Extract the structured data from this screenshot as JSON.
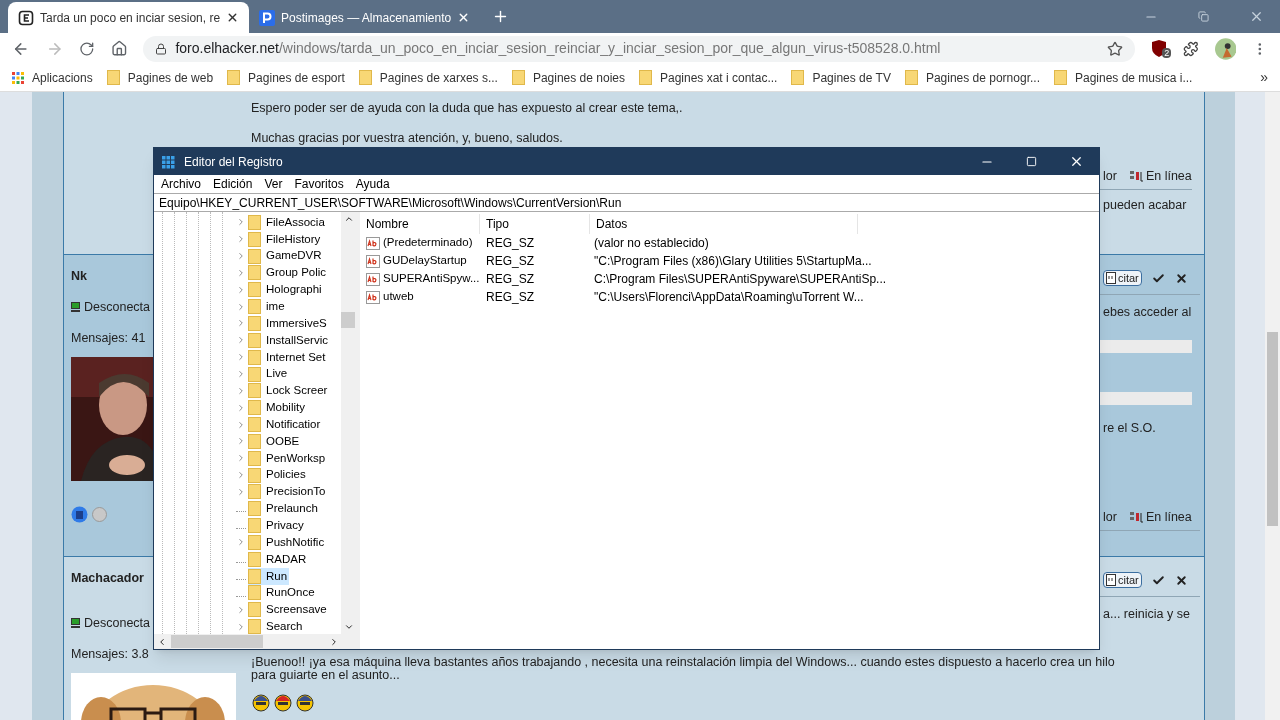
{
  "browser": {
    "tabs": [
      {
        "title": "Tarda un poco en inciar sesion, re",
        "kind": "forum",
        "selected": true
      },
      {
        "title": "Postimages — Almacenamiento",
        "kind": "postimages",
        "selected": false
      }
    ],
    "url": {
      "host": "foro.elhacker.net",
      "path": "/windows/tarda_un_poco_en_inciar_sesion_reinciar_y_inciar_sesion_por_que_algun_virus-t508528.0.html"
    },
    "extension_badge": "2",
    "bookmarks": [
      {
        "label": "Aplicacions",
        "kind": "apps"
      },
      {
        "label": "Pagines de web",
        "kind": "folder"
      },
      {
        "label": "Pagines de esport",
        "kind": "folder"
      },
      {
        "label": "Pagines de xarxes s...",
        "kind": "folder"
      },
      {
        "label": "Pagines de noies",
        "kind": "folder"
      },
      {
        "label": "Pagines xat i contac...",
        "kind": "folder"
      },
      {
        "label": "Pagines de TV",
        "kind": "folder"
      },
      {
        "label": "Pagines de pornogr...",
        "kind": "folder"
      },
      {
        "label": "Pagines de musica i...",
        "kind": "folder"
      }
    ],
    "bookmarks_overflow": "»"
  },
  "forum": {
    "top_post": {
      "lines": [
        "Espero poder ser de ayuda con la duda que has expuesto al crear este tema,.",
        "Muchas gracias por vuestra atención, y, bueno, saludos."
      ],
      "footer_left": "lor",
      "footer_status": "En línea",
      "side_text": "pueden acabar"
    },
    "posts": [
      {
        "author": "Nk",
        "status": "Desconecta",
        "messages": "Mensajes: 41",
        "quote": "citar",
        "side_text": [
          "ebes acceder al",
          "re el S.O."
        ],
        "footer_left": "lor",
        "footer_status": "En línea"
      },
      {
        "author": "Machacador",
        "status": "Desconecta",
        "messages": "Mensajes: 3.8",
        "quote": "citar",
        "side_text": [
          "a... reinicia y se"
        ],
        "body": [
          "¡Buenoo!! ¡ya esa máquina lleva bastantes años trabajando , necesita una reinstalación limpia del Windows... cuando estes dispuesto a hacerlo crea un hilo",
          "para guiarte en el asunto..."
        ],
        "smileys": [
          {
            "color": "#3b4f8a"
          },
          {
            "color": "#d52525"
          },
          {
            "color": "#3b4f8a"
          }
        ]
      }
    ]
  },
  "window": {
    "title": "Editor del Registro",
    "menu": [
      "Archivo",
      "Edición",
      "Ver",
      "Favoritos",
      "Ayuda"
    ],
    "address": "Equipo\\HKEY_CURRENT_USER\\SOFTWARE\\Microsoft\\Windows\\CurrentVersion\\Run",
    "tree": [
      {
        "label": "FileAssocia",
        "expandable": true,
        "selected": false
      },
      {
        "label": "FileHistory",
        "expandable": true,
        "selected": false
      },
      {
        "label": "GameDVR",
        "expandable": true,
        "selected": false
      },
      {
        "label": "Group Polic",
        "expandable": true,
        "selected": false
      },
      {
        "label": "Holographi",
        "expandable": true,
        "selected": false
      },
      {
        "label": "ime",
        "expandable": true,
        "selected": false
      },
      {
        "label": "ImmersiveS",
        "expandable": true,
        "selected": false
      },
      {
        "label": "InstallServic",
        "expandable": true,
        "selected": false
      },
      {
        "label": "Internet Set",
        "expandable": true,
        "selected": false
      },
      {
        "label": "Live",
        "expandable": true,
        "selected": false
      },
      {
        "label": "Lock Screer",
        "expandable": true,
        "selected": false
      },
      {
        "label": "Mobility",
        "expandable": true,
        "selected": false
      },
      {
        "label": "Notificatior",
        "expandable": true,
        "selected": false
      },
      {
        "label": "OOBE",
        "expandable": true,
        "selected": false
      },
      {
        "label": "PenWorksp",
        "expandable": true,
        "selected": false
      },
      {
        "label": "Policies",
        "expandable": true,
        "selected": false
      },
      {
        "label": "PrecisionTo",
        "expandable": true,
        "selected": false
      },
      {
        "label": "Prelaunch",
        "expandable": false,
        "selected": false
      },
      {
        "label": "Privacy",
        "expandable": false,
        "selected": false
      },
      {
        "label": "PushNotific",
        "expandable": true,
        "selected": false
      },
      {
        "label": "RADAR",
        "expandable": false,
        "selected": false
      },
      {
        "label": "Run",
        "expandable": false,
        "selected": true
      },
      {
        "label": "RunOnce",
        "expandable": false,
        "selected": false
      },
      {
        "label": "Screensave",
        "expandable": true,
        "selected": false
      },
      {
        "label": "Search",
        "expandable": true,
        "selected": false
      }
    ],
    "columns": [
      "Nombre",
      "Tipo",
      "Datos"
    ],
    "rows": [
      {
        "name": "(Predeterminado)",
        "type": "REG_SZ",
        "data": "(valor no establecido)"
      },
      {
        "name": "GUDelayStartup",
        "type": "REG_SZ",
        "data": "\"C:\\Program Files (x86)\\Glary Utilities 5\\StartupMa..."
      },
      {
        "name": "SUPERAntiSpyw...",
        "type": "REG_SZ",
        "data": "C:\\Program Files\\SUPERAntiSpyware\\SUPERAntiSp..."
      },
      {
        "name": "utweb",
        "type": "REG_SZ",
        "data": "\"C:\\Users\\Florenci\\AppData\\Roaming\\uTorrent W..."
      }
    ]
  }
}
